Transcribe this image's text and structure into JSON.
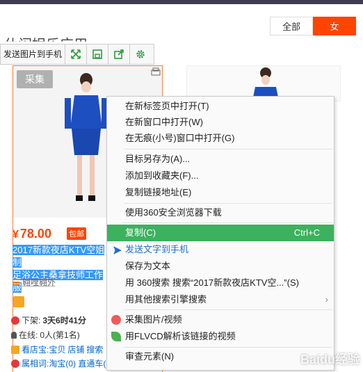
{
  "filter": {
    "all": "全部",
    "female": "女"
  },
  "page_title": "休闲娱乐应用",
  "toolbar": {
    "send_image": "发送图片到手机",
    "icons": [
      "expand-icon",
      "save-icon",
      "share-icon",
      "settings-icon"
    ]
  },
  "product": {
    "collect_label": "采集",
    "price": "78.00",
    "currency": "¥",
    "free_shipping": "包邮",
    "title_line1": "2017新款夜店KTV空姐制",
    "title_line2": "足浴公主桑拿技师工作服",
    "shop_name": "翱哩翱外",
    "time_label": "下架:",
    "time_value": "3天6时41分",
    "online_label": "在线:",
    "online_value": "0人(第1名)",
    "link_store": "看店宝:宝贝",
    "link_shop": "店铺",
    "link_search": "搜索",
    "keyword_row": "属相词:淘宝(0) 直通车("
  },
  "context_menu": {
    "items": [
      {
        "label": "在新标签页中打开(T)"
      },
      {
        "label": "在新窗口中打开(W)"
      },
      {
        "label": "在无痕(小号)窗口中打开(G)"
      },
      {
        "label": "目标另存为(A)..."
      },
      {
        "label": "添加到收藏夹(F)..."
      },
      {
        "label": "复制链接地址(E)"
      },
      {
        "label": "使用360安全浏览器下载"
      },
      {
        "label": "复制(C)",
        "shortcut": "Ctrl+C"
      },
      {
        "label": "发送文字到手机"
      },
      {
        "label": "保存为文本"
      },
      {
        "label": "用 360搜索 搜索“2017新款夜店KTV空...”(S)"
      },
      {
        "label": "用其他搜索引擎搜索"
      },
      {
        "label": "采集图片/视频"
      },
      {
        "label": "用FLVCD解析该链接的视频"
      },
      {
        "label": "审查元素(N)"
      }
    ]
  },
  "watermark": "Baidu经验",
  "colors": {
    "accent": "#ff4400",
    "menu_highlight": "#3cb15e",
    "selection": "#3399ff"
  }
}
